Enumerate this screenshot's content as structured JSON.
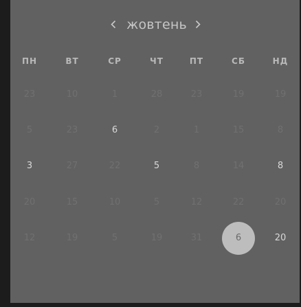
{
  "calendar": {
    "month": "жовтень",
    "weekdays": [
      "ПН",
      "ВТ",
      "СР",
      "ЧТ",
      "ПТ",
      "СБ",
      "НД"
    ],
    "weeks": [
      [
        {
          "d": "23",
          "s": "muted"
        },
        {
          "d": "10",
          "s": "muted"
        },
        {
          "d": "1",
          "s": "muted"
        },
        {
          "d": "28",
          "s": "muted"
        },
        {
          "d": "23",
          "s": "muted"
        },
        {
          "d": "19",
          "s": "muted"
        },
        {
          "d": "19",
          "s": "muted"
        }
      ],
      [
        {
          "d": "5",
          "s": "muted"
        },
        {
          "d": "23",
          "s": "muted"
        },
        {
          "d": "6",
          "s": "normal"
        },
        {
          "d": "2",
          "s": "muted"
        },
        {
          "d": "1",
          "s": "muted"
        },
        {
          "d": "15",
          "s": "muted"
        },
        {
          "d": "8",
          "s": "muted"
        }
      ],
      [
        {
          "d": "3",
          "s": "normal"
        },
        {
          "d": "27",
          "s": "muted"
        },
        {
          "d": "22",
          "s": "muted"
        },
        {
          "d": "5",
          "s": "normal"
        },
        {
          "d": "8",
          "s": "muted"
        },
        {
          "d": "14",
          "s": "muted"
        },
        {
          "d": "8",
          "s": "normal"
        }
      ],
      [
        {
          "d": "20",
          "s": "muted"
        },
        {
          "d": "15",
          "s": "muted"
        },
        {
          "d": "10",
          "s": "muted"
        },
        {
          "d": "5",
          "s": "muted"
        },
        {
          "d": "12",
          "s": "muted"
        },
        {
          "d": "22",
          "s": "muted"
        },
        {
          "d": "20",
          "s": "muted"
        }
      ],
      [
        {
          "d": "12",
          "s": "muted"
        },
        {
          "d": "19",
          "s": "muted"
        },
        {
          "d": "5",
          "s": "muted"
        },
        {
          "d": "19",
          "s": "muted"
        },
        {
          "d": "31",
          "s": "muted"
        },
        {
          "d": "6",
          "s": "sel"
        },
        {
          "d": "20",
          "s": "normal"
        }
      ]
    ]
  }
}
